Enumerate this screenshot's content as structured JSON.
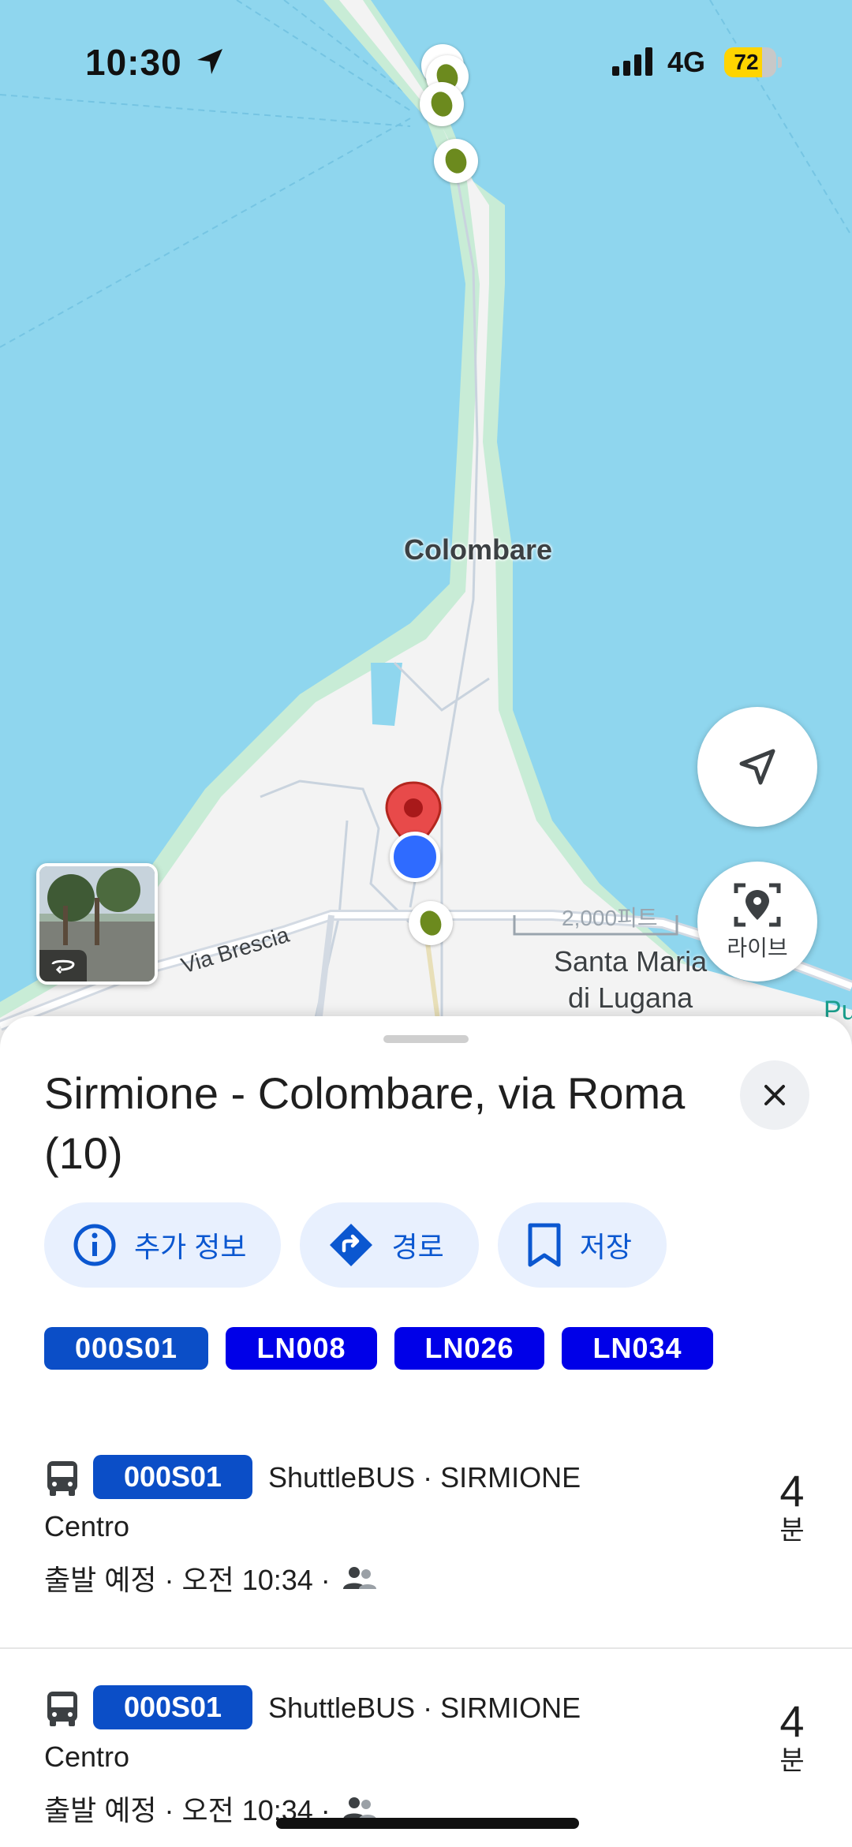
{
  "status_bar": {
    "time": "10:30",
    "network": "4G",
    "battery": "72",
    "battery_level": 0.72
  },
  "map": {
    "place_label": "Colombare",
    "road_label": "Via Brescia",
    "town_label_line1": "Santa Maria",
    "town_label_line2": "di Lugana",
    "scale_label": "2,000피트",
    "edge_label": "Pu",
    "live_button_label": "라이브"
  },
  "stop": {
    "title": "Sirmione - Colombare, via Roma (10)",
    "actions": [
      {
        "label": "추가 정보",
        "icon": "info-icon"
      },
      {
        "label": "경로",
        "icon": "directions-icon"
      },
      {
        "label": "저장",
        "icon": "bookmark-icon"
      }
    ],
    "routes": [
      {
        "code": "000S01",
        "color": "#0b4ec7"
      },
      {
        "code": "LN008",
        "color": "#0000e8"
      },
      {
        "code": "LN026",
        "color": "#0000e8"
      },
      {
        "code": "LN034",
        "color": "#0000e8"
      }
    ]
  },
  "departures": [
    {
      "route": "000S01",
      "agency": "ShuttleBUS · SIRMIONE",
      "destination": "Centro",
      "schedule": "출발 예정 · 오전 10:34 ·",
      "minutes": "4",
      "unit": "분"
    },
    {
      "route": "000S01",
      "agency": "ShuttleBUS · SIRMIONE",
      "destination": "Centro",
      "schedule": "출발 예정 · 오전 10:34 ·",
      "minutes": "4",
      "unit": "분"
    }
  ]
}
